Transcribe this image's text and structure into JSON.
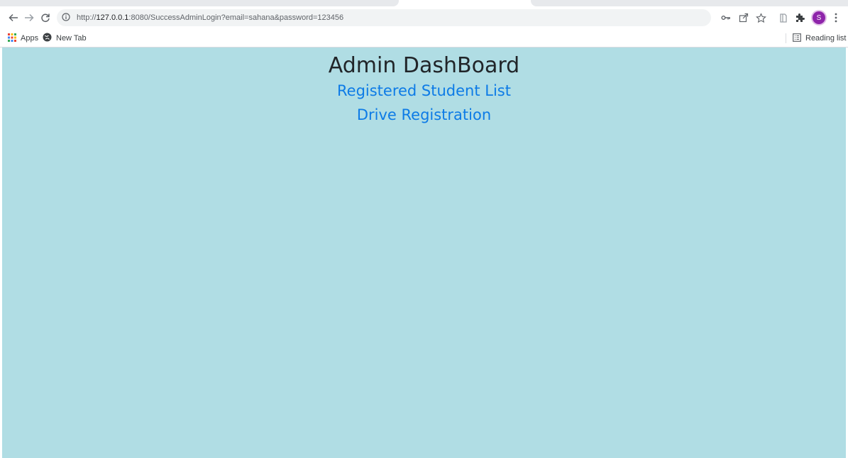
{
  "browser": {
    "url_prefix": "http://",
    "url_host": "127.0.0.1",
    "url_rest": ":8080/SuccessAdminLogin?email=sahana&password=123456",
    "avatar_letter": "S",
    "avatar_color": "#8e24aa",
    "icons": {
      "back": "back-arrow-icon",
      "forward": "forward-arrow-icon",
      "reload": "reload-icon",
      "info": "info-icon",
      "key": "key-icon",
      "share": "share-icon",
      "star": "star-icon",
      "extension_a": "extension-icon",
      "puzzle": "puzzle-icon",
      "menu": "kebab-menu-icon"
    }
  },
  "bookmarks": {
    "apps_label": "Apps",
    "newtab_label": "New Tab",
    "reading_list_label": "Reading list"
  },
  "page": {
    "background": "#b0dde4",
    "title": "Admin DashBoard",
    "link_color": "#0d7be6",
    "links": [
      {
        "label": "Registered Student List"
      },
      {
        "label": "Drive Registration"
      }
    ]
  }
}
